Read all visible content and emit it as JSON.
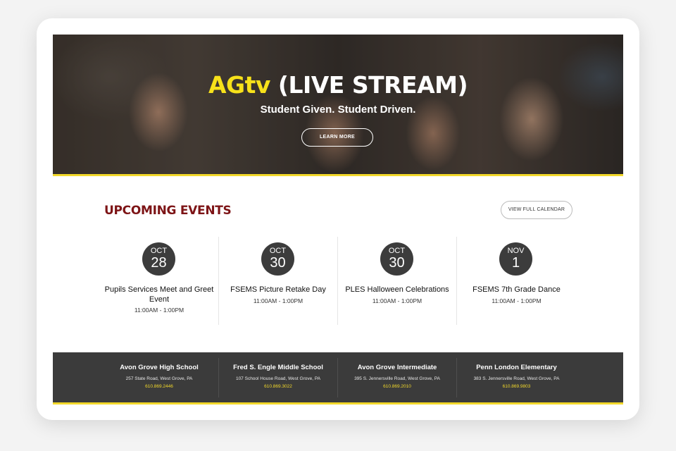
{
  "hero": {
    "title_accent": "AGtv",
    "title_rest": " (LIVE STREAM)",
    "subtitle": "Student Given. Student Driven.",
    "cta_label": "LEARN MORE"
  },
  "events": {
    "heading": "UPCOMING EVENTS",
    "calendar_button": "VIEW FULL CALENDAR",
    "items": [
      {
        "month": "OCT",
        "day": "28",
        "name": "Pupils Services Meet and Greet Event",
        "time": "11:00AM - 1:00PM"
      },
      {
        "month": "OCT",
        "day": "30",
        "name": "FSEMS Picture Retake Day",
        "time": "11:00AM - 1:00PM"
      },
      {
        "month": "OCT",
        "day": "30",
        "name": "PLES Halloween Celebrations",
        "time": "11:00AM - 1:00PM"
      },
      {
        "month": "NOV",
        "day": "1",
        "name": "FSEMS 7th Grade Dance",
        "time": "11:00AM - 1:00PM"
      }
    ]
  },
  "footer": {
    "schools": [
      {
        "name": "Avon Grove High School",
        "address": "257 State Road, West Grove, PA",
        "phone": "610.869.2446"
      },
      {
        "name": "Fred S. Engle Middle School",
        "address": "107 School House Road, West Grove, PA",
        "phone": "610.869.3022"
      },
      {
        "name": "Avon Grove Intermediate",
        "address": "395 S. Jennersville Road, West Grove, PA",
        "phone": "610.869.2010"
      },
      {
        "name": "Penn London Elementary",
        "address": "383 S. Jennersville Road, West Grove, PA",
        "phone": "610.869.9803"
      }
    ]
  },
  "colors": {
    "accent_yellow": "#f7e11a",
    "heading_maroon": "#7d1416",
    "dark_gray": "#3b3b3b"
  }
}
